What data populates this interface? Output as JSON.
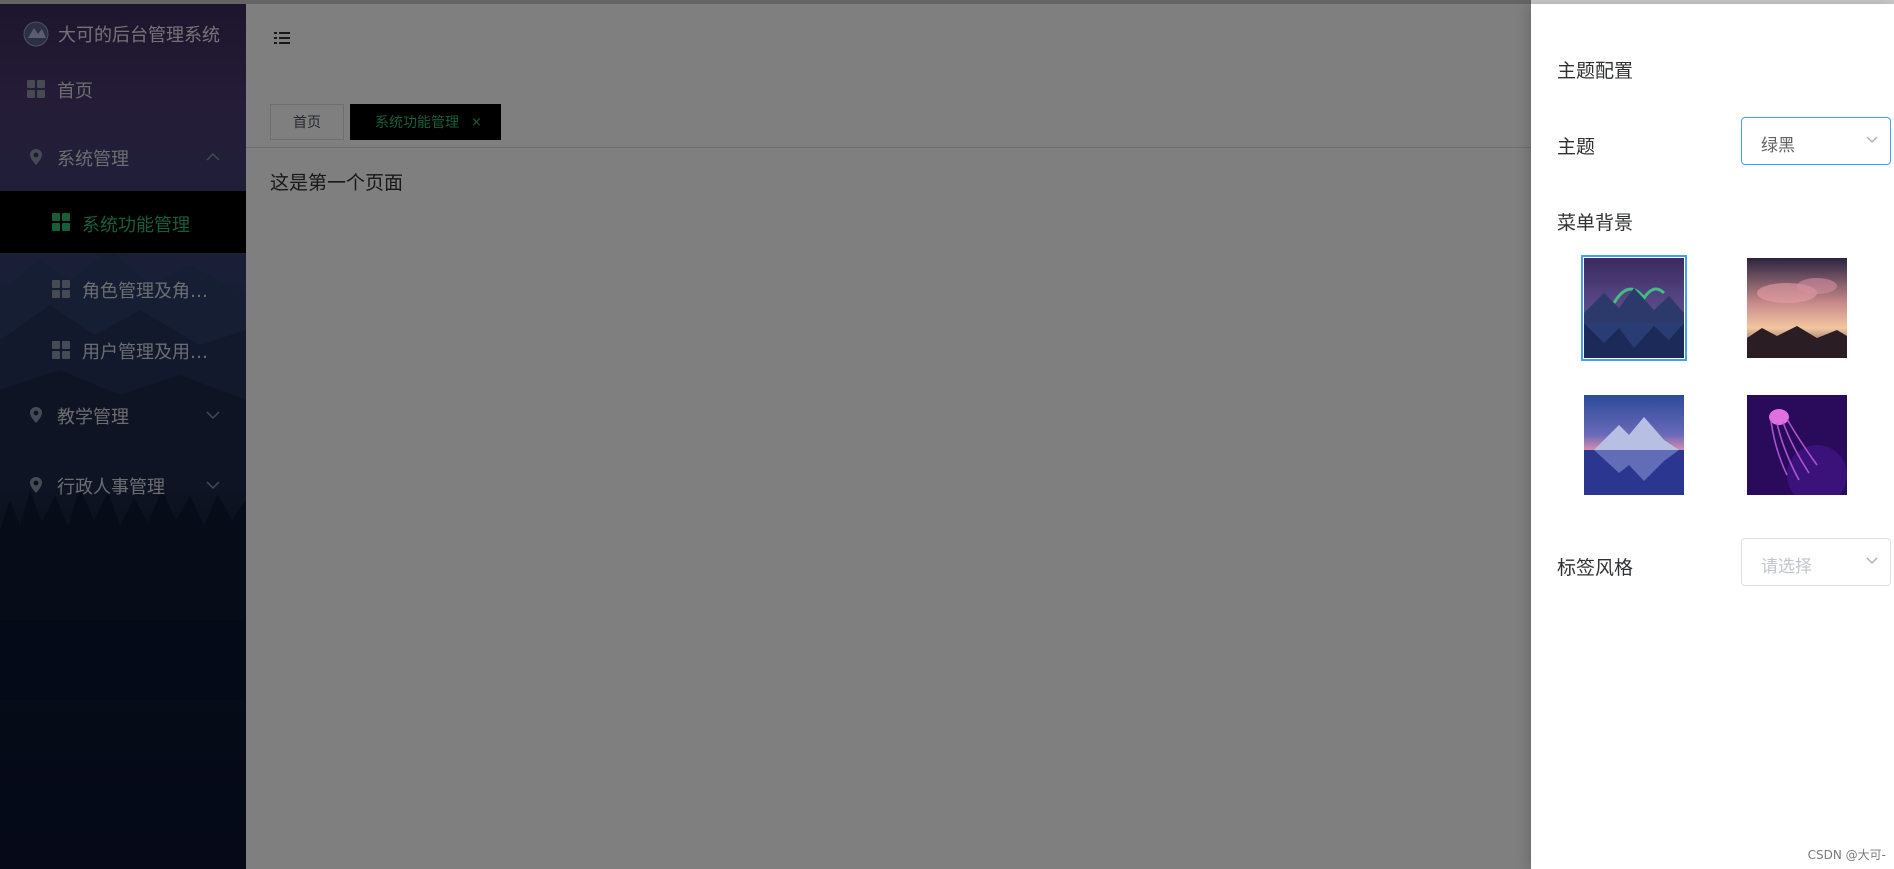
{
  "app": {
    "title": "大可的后台管理系统"
  },
  "sidebar": {
    "menu": [
      {
        "label": "首页",
        "icon": "grid-icon"
      },
      {
        "label": "系统管理",
        "icon": "location-pin-icon",
        "expanded": true,
        "children": [
          {
            "label": "系统功能管理",
            "active": true
          },
          {
            "label": "角色管理及角…"
          },
          {
            "label": "用户管理及用…"
          }
        ]
      },
      {
        "label": "教学管理",
        "icon": "location-pin-icon"
      },
      {
        "label": "行政人事管理",
        "icon": "location-pin-icon"
      }
    ]
  },
  "header": {
    "toggle_icon": "hamburger-menu-icon"
  },
  "tabs": [
    {
      "label": "首页",
      "active": false
    },
    {
      "label": "系统功能管理",
      "active": true,
      "close": "×"
    }
  ],
  "content": {
    "text": "这是第一个页面"
  },
  "theme_drawer": {
    "title": "主题配置",
    "theme": {
      "label": "主题",
      "value": "绿黑"
    },
    "menu_background": {
      "label": "菜单背景",
      "selected_index": 0
    },
    "tag_style": {
      "label": "标签风格",
      "placeholder": "请选择"
    }
  },
  "watermark": "CSDN @大可-",
  "colors": {
    "accent_green": "#2ebc70",
    "focus_blue": "#409eff",
    "mask": "rgba(0,0,0,0.5)"
  }
}
